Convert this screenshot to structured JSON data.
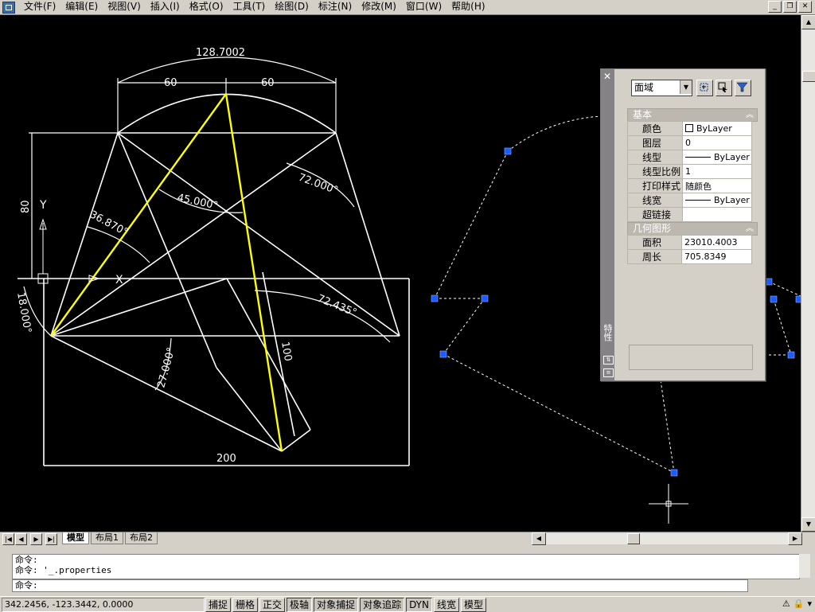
{
  "menubar": {
    "items": [
      "文件(F)",
      "编辑(E)",
      "视图(V)",
      "插入(I)",
      "格式(O)",
      "工具(T)",
      "绘图(D)",
      "标注(N)",
      "修改(M)",
      "窗口(W)",
      "帮助(H)"
    ]
  },
  "drawing": {
    "dims": {
      "arc": "128.7002",
      "top_left": "60",
      "top_right": "60",
      "left_height": "80",
      "angle_36": "36.870°",
      "angle_45": "45.000°",
      "angle_72": "72.000°",
      "angle_72_435": "72.435°",
      "angle_18": "18.000°",
      "angle_27": "27.000°",
      "len_100": "100",
      "bottom": "200"
    },
    "ucs": {
      "y": "Y",
      "x": "X"
    }
  },
  "palette": {
    "type_value": "面域",
    "sections": {
      "basic": "基本",
      "geometry": "几何图形"
    },
    "basic_rows": [
      {
        "label": "颜色",
        "value": "ByLayer"
      },
      {
        "label": "图层",
        "value": "0"
      },
      {
        "label": "线型",
        "value": "ByLayer"
      },
      {
        "label": "线型比例",
        "value": "1"
      },
      {
        "label": "打印样式",
        "value": "随颜色"
      },
      {
        "label": "线宽",
        "value": "ByLayer"
      },
      {
        "label": "超链接",
        "value": ""
      }
    ],
    "geometry_rows": [
      {
        "label": "面积",
        "value": "23010.4003"
      },
      {
        "label": "周长",
        "value": "705.8349"
      }
    ],
    "side_label": "特性"
  },
  "layout_tabs": [
    "模型",
    "布局1",
    "布局2"
  ],
  "command": {
    "history": [
      "命令:",
      "命令: '_.properties"
    ],
    "prompt": "命令:"
  },
  "status": {
    "coords": "342.2456, -123.3442, 0.0000",
    "toggles": [
      "捕捉",
      "栅格",
      "正交",
      "极轴",
      "对象捕捉",
      "对象追踪",
      "DYN",
      "线宽",
      "模型"
    ]
  },
  "colors": {
    "canvas": "#000000",
    "geometry": "#ffffff",
    "highlight": "#ffff00",
    "grip": "#0050ff"
  }
}
